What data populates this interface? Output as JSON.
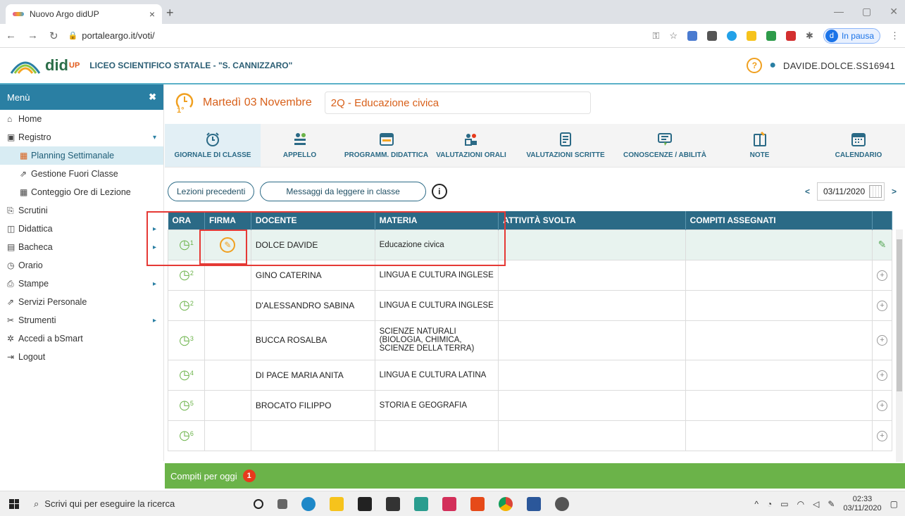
{
  "browser": {
    "tab_title": "Nuovo Argo didUP",
    "tab_close": "×",
    "new_tab": "+",
    "url": "portaleargo.it/voti/",
    "profile_initial": "d",
    "profile_status": "In pausa"
  },
  "app": {
    "brand": "did",
    "brand_sup": "UP",
    "school": "LICEO SCIENTIFICO STATALE - \"S. CANNIZZARO\"",
    "help": "?",
    "user": "DAVIDE.DOLCE.SS16941"
  },
  "sidebar": {
    "title": "Menù",
    "close": "✖",
    "items": [
      {
        "label": "Home",
        "icon": "home-icon",
        "glyph": "⌂"
      },
      {
        "label": "Registro",
        "icon": "calendar-icon",
        "glyph": "▣",
        "expand": "▾"
      },
      {
        "label": "Planning Settimanale",
        "icon": "planning-icon",
        "glyph": "▦"
      },
      {
        "label": "Gestione Fuori Classe",
        "icon": "external-icon",
        "glyph": "⇗"
      },
      {
        "label": "Conteggio Ore di Lezione",
        "icon": "grid-icon",
        "glyph": "▦"
      },
      {
        "label": "Scrutini",
        "icon": "scrutini-icon",
        "glyph": "⎘"
      },
      {
        "label": "Didattica",
        "icon": "book-icon",
        "glyph": "◫",
        "expand": "▸"
      },
      {
        "label": "Bacheca",
        "icon": "board-icon",
        "glyph": "▤",
        "expand": "▸"
      },
      {
        "label": "Orario",
        "icon": "clock-icon",
        "glyph": "◷"
      },
      {
        "label": "Stampe",
        "icon": "printer-icon",
        "glyph": "⎙",
        "expand": "▸"
      },
      {
        "label": "Servizi Personale",
        "icon": "services-icon",
        "glyph": "⇗"
      },
      {
        "label": "Strumenti",
        "icon": "tools-icon",
        "glyph": "✂",
        "expand": "▸"
      },
      {
        "label": "Accedi a bSmart",
        "icon": "bsmart-icon",
        "glyph": "✲"
      },
      {
        "label": "Logout",
        "icon": "logout-icon",
        "glyph": "⇥"
      }
    ]
  },
  "day": {
    "date": "Martedì 03 Novembre",
    "class": "2Q - Educazione civica"
  },
  "iconbar": [
    "GIORNALE DI CLASSE",
    "APPELLO",
    "PROGRAMM. DIDATTICA",
    "VALUTAZIONI ORALI",
    "VALUTAZIONI SCRITTE",
    "CONOSCENZE / ABILITÀ",
    "NOTE",
    "CALENDARIO"
  ],
  "actions": {
    "prev_lessons": "Lezioni precedenti",
    "messages": "Messaggi da leggere in classe",
    "info": "i",
    "prev": "<",
    "next": ">",
    "date": "03/11/2020"
  },
  "table": {
    "headers": [
      "ORA",
      "FIRMA",
      "DOCENTE",
      "MATERIA",
      "ATTIVITÀ SVOLTA",
      "COMPITI ASSEGNATI"
    ],
    "rows": [
      {
        "ora": "1",
        "docente": "DOLCE DAVIDE",
        "materia": "Educazione civica"
      },
      {
        "ora": "2",
        "docente": "GINO CATERINA",
        "materia": "LINGUA E CULTURA INGLESE"
      },
      {
        "ora": "2",
        "docente": "D'ALESSANDRO SABINA",
        "materia": "LINGUA E CULTURA INGLESE"
      },
      {
        "ora": "3",
        "docente": "BUCCA ROSALBA",
        "materia": "SCIENZE NATURALI (BIOLOGIA, CHIMICA, SCIENZE DELLA TERRA)"
      },
      {
        "ora": "4",
        "docente": "DI PACE MARIA ANITA",
        "materia": "LINGUA E CULTURA LATINA"
      },
      {
        "ora": "5",
        "docente": "BROCATO FILIPPO",
        "materia": "STORIA E GEOGRAFIA"
      },
      {
        "ora": "6",
        "docente": "",
        "materia": ""
      }
    ]
  },
  "footer": {
    "compiti": "Compiti per oggi",
    "badge": "1"
  },
  "taskbar": {
    "search": "Scrivi qui per eseguire la ricerca",
    "time": "02:33",
    "date": "03/11/2020"
  },
  "colors": {
    "primary": "#2b6a86",
    "accent_orange": "#d8601a",
    "green": "#6bb349"
  }
}
